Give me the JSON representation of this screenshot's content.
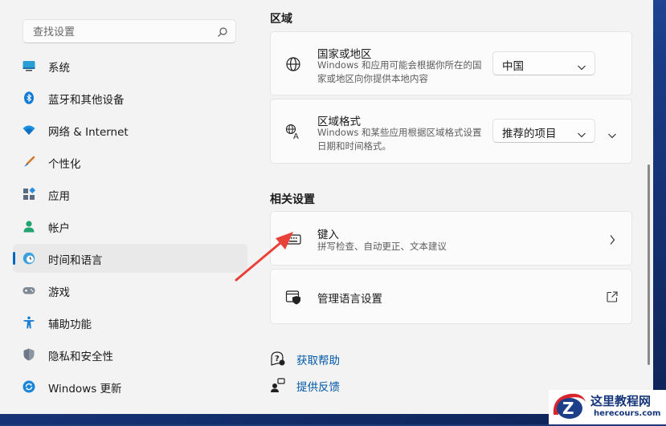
{
  "search": {
    "placeholder": "查找设置",
    "icon": "search-icon"
  },
  "sidebar": {
    "items": [
      {
        "label": "系统",
        "icon": "monitor-icon",
        "active": false
      },
      {
        "label": "蓝牙和其他设备",
        "icon": "bluetooth-icon",
        "active": false
      },
      {
        "label": "网络 & Internet",
        "icon": "wifi-icon",
        "active": false
      },
      {
        "label": "个性化",
        "icon": "brush-icon",
        "active": false
      },
      {
        "label": "应用",
        "icon": "apps-icon",
        "active": false
      },
      {
        "label": "帐户",
        "icon": "person-icon",
        "active": false
      },
      {
        "label": "时间和语言",
        "icon": "clock-globe-icon",
        "active": true
      },
      {
        "label": "游戏",
        "icon": "gamepad-icon",
        "active": false
      },
      {
        "label": "辅助功能",
        "icon": "accessibility-icon",
        "active": false
      },
      {
        "label": "隐私和安全性",
        "icon": "shield-icon",
        "active": false
      },
      {
        "label": "Windows 更新",
        "icon": "update-icon",
        "active": false
      }
    ]
  },
  "region": {
    "title": "区域",
    "country": {
      "title": "国家或地区",
      "desc": "Windows 和应用可能会根据你所在的国家或地区向你提供本地内容",
      "value": "中国"
    },
    "format": {
      "title": "区域格式",
      "desc": "Windows 和某些应用根据区域格式设置日期和时间格式。",
      "value": "推荐的项目"
    }
  },
  "related": {
    "title": "相关设置",
    "typing": {
      "title": "键入",
      "desc": "拼写检查、自动更正、文本建议"
    },
    "language_admin": {
      "title": "管理语言设置"
    }
  },
  "links": {
    "help": "获取帮助",
    "feedback": "提供反馈"
  },
  "watermark": {
    "title": "这里教程网",
    "url": "herecours.com"
  },
  "colors": {
    "accent": "#0067c0",
    "link": "#0058a8",
    "arrow": "#e8413a"
  }
}
